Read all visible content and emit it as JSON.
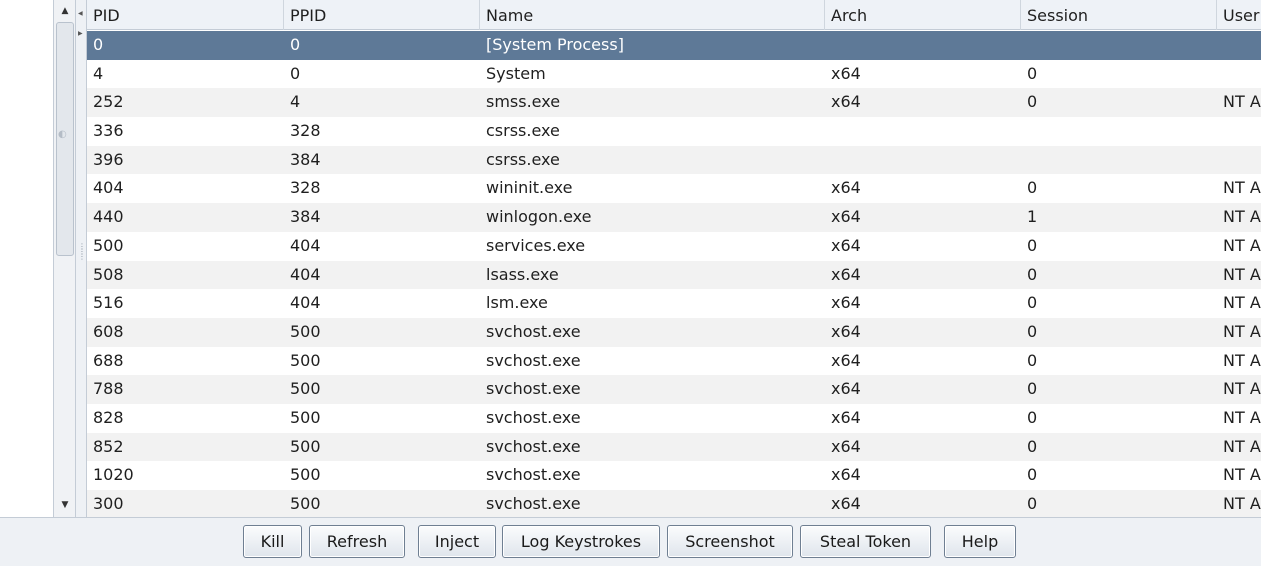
{
  "table": {
    "columns": [
      "PID",
      "PPID",
      "Name",
      "Arch",
      "Session",
      "User"
    ],
    "rows": [
      {
        "pid": "0",
        "ppid": "0",
        "name": "[System Process]",
        "arch": "",
        "session": "",
        "user": "",
        "selected": true
      },
      {
        "pid": "4",
        "ppid": "0",
        "name": "System",
        "arch": "x64",
        "session": "0",
        "user": ""
      },
      {
        "pid": "252",
        "ppid": "4",
        "name": "smss.exe",
        "arch": "x64",
        "session": "0",
        "user": "NT A"
      },
      {
        "pid": "336",
        "ppid": "328",
        "name": "csrss.exe",
        "arch": "",
        "session": "",
        "user": ""
      },
      {
        "pid": "396",
        "ppid": "384",
        "name": "csrss.exe",
        "arch": "",
        "session": "",
        "user": ""
      },
      {
        "pid": "404",
        "ppid": "328",
        "name": "wininit.exe",
        "arch": "x64",
        "session": "0",
        "user": "NT A"
      },
      {
        "pid": "440",
        "ppid": "384",
        "name": "winlogon.exe",
        "arch": "x64",
        "session": "1",
        "user": "NT A"
      },
      {
        "pid": "500",
        "ppid": "404",
        "name": "services.exe",
        "arch": "x64",
        "session": "0",
        "user": "NT A"
      },
      {
        "pid": "508",
        "ppid": "404",
        "name": "lsass.exe",
        "arch": "x64",
        "session": "0",
        "user": "NT A"
      },
      {
        "pid": "516",
        "ppid": "404",
        "name": "lsm.exe",
        "arch": "x64",
        "session": "0",
        "user": "NT A"
      },
      {
        "pid": "608",
        "ppid": "500",
        "name": "svchost.exe",
        "arch": "x64",
        "session": "0",
        "user": "NT A"
      },
      {
        "pid": "688",
        "ppid": "500",
        "name": "svchost.exe",
        "arch": "x64",
        "session": "0",
        "user": "NT A"
      },
      {
        "pid": "788",
        "ppid": "500",
        "name": "svchost.exe",
        "arch": "x64",
        "session": "0",
        "user": "NT A"
      },
      {
        "pid": "828",
        "ppid": "500",
        "name": "svchost.exe",
        "arch": "x64",
        "session": "0",
        "user": "NT A"
      },
      {
        "pid": "852",
        "ppid": "500",
        "name": "svchost.exe",
        "arch": "x64",
        "session": "0",
        "user": "NT A"
      },
      {
        "pid": "1020",
        "ppid": "500",
        "name": "svchost.exe",
        "arch": "x64",
        "session": "0",
        "user": "NT A"
      },
      {
        "pid": "300",
        "ppid": "500",
        "name": "svchost.exe",
        "arch": "x64",
        "session": "0",
        "user": "NT A"
      }
    ]
  },
  "buttons": {
    "kill": "Kill",
    "refresh": "Refresh",
    "inject": "Inject",
    "log_keystrokes": "Log Keystrokes",
    "screenshot": "Screenshot",
    "steal_token": "Steal Token",
    "help": "Help"
  },
  "colors": {
    "selected_row": "#5e7997",
    "header_bg": "#eef2f7",
    "stripe": "#f2f2f2"
  }
}
